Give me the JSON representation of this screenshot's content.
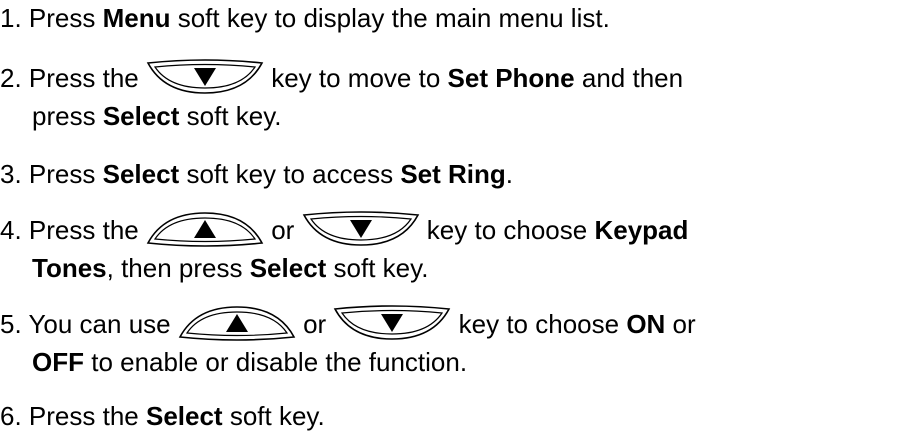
{
  "steps": [
    {
      "number": "1.",
      "lines": [
        {
          "parts": [
            {
              "t": "text",
              "v": "Press "
            },
            {
              "t": "bold",
              "v": "Menu"
            },
            {
              "t": "text",
              "v": " soft key to display the main menu list."
            }
          ]
        }
      ]
    },
    {
      "number": "2.",
      "lines": [
        {
          "parts": [
            {
              "t": "text",
              "v": "Press the "
            },
            {
              "t": "key",
              "icon": "down-key"
            },
            {
              "t": "text",
              "v": " key to move to "
            },
            {
              "t": "bold",
              "v": "Set Phone"
            },
            {
              "t": "text",
              "v": " and then"
            }
          ]
        },
        {
          "parts": [
            {
              "t": "text",
              "v": "press "
            },
            {
              "t": "bold",
              "v": "Select"
            },
            {
              "t": "text",
              "v": " soft key."
            }
          ]
        }
      ]
    },
    {
      "number": "3.",
      "lines": [
        {
          "parts": [
            {
              "t": "text",
              "v": "Press "
            },
            {
              "t": "bold",
              "v": "Select"
            },
            {
              "t": "text",
              "v": " soft key to access "
            },
            {
              "t": "bold",
              "v": "Set Ring"
            },
            {
              "t": "text",
              "v": "."
            }
          ]
        }
      ]
    },
    {
      "number": "4.",
      "lines": [
        {
          "parts": [
            {
              "t": "text",
              "v": "Press the "
            },
            {
              "t": "key",
              "icon": "up-key"
            },
            {
              "t": "text",
              "v": " or "
            },
            {
              "t": "key",
              "icon": "down-key"
            },
            {
              "t": "text",
              "v": " key to choose "
            },
            {
              "t": "bold",
              "v": "Keypad"
            }
          ]
        },
        {
          "parts": [
            {
              "t": "bold",
              "v": "Tones"
            },
            {
              "t": "text",
              "v": ", then press "
            },
            {
              "t": "bold",
              "v": "Select"
            },
            {
              "t": "text",
              "v": " soft key."
            }
          ]
        }
      ]
    },
    {
      "number": "5.",
      "lines": [
        {
          "parts": [
            {
              "t": "text",
              "v": "You can use "
            },
            {
              "t": "key",
              "icon": "up-key"
            },
            {
              "t": "text",
              "v": " or "
            },
            {
              "t": "key",
              "icon": "down-key"
            },
            {
              "t": "text",
              "v": " key to choose "
            },
            {
              "t": "bold",
              "v": "ON"
            },
            {
              "t": "text",
              "v": " or"
            }
          ]
        },
        {
          "parts": [
            {
              "t": "bold",
              "v": "OFF"
            },
            {
              "t": "text",
              "v": " to enable or disable the function."
            }
          ]
        }
      ]
    },
    {
      "number": "6.",
      "lines": [
        {
          "parts": [
            {
              "t": "text",
              "v": "Press the "
            },
            {
              "t": "bold",
              "v": "Select"
            },
            {
              "t": "text",
              "v": " soft key."
            }
          ]
        }
      ]
    }
  ]
}
